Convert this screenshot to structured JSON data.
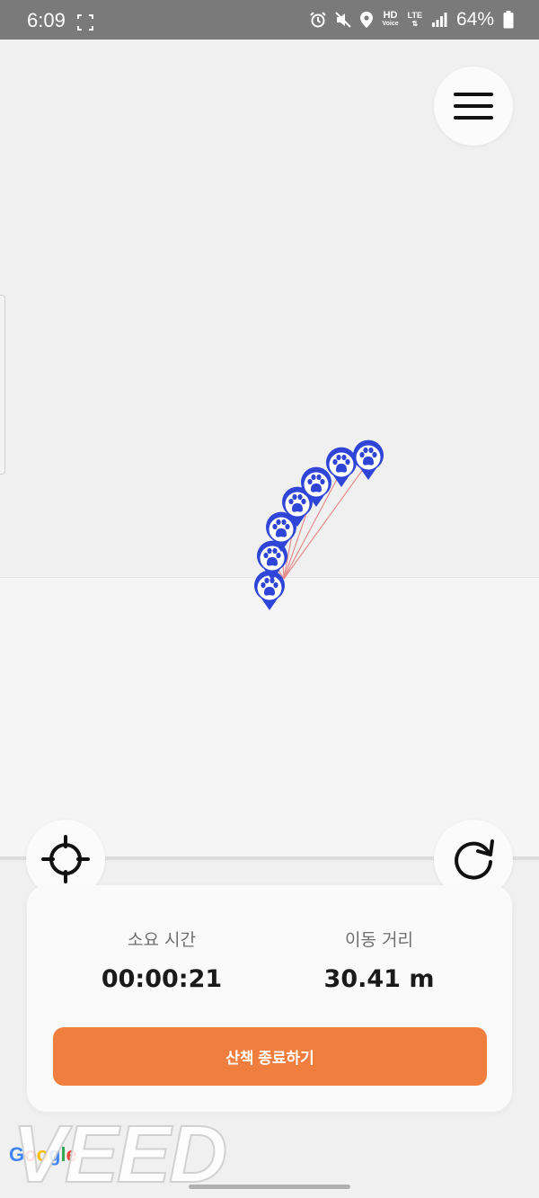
{
  "status_bar": {
    "time": "6:09",
    "hd_top": "HD",
    "hd_bottom": "Voice",
    "lte": "LTE",
    "battery": "64%"
  },
  "colors": {
    "accent": "#f07e3f",
    "marker": "#2f45d8",
    "path": "#e26a6a"
  },
  "icons": {
    "menu": "menu-icon",
    "locate": "crosshair-icon",
    "refresh": "refresh-icon",
    "marker": "paw-marker-icon"
  },
  "stats": {
    "time_label": "소요 시간",
    "time_value": "00:00:21",
    "distance_label": "이동 거리",
    "distance_value": "30.41 m"
  },
  "end_button": "산책 종료하기",
  "google_logo": "Google",
  "watermark": "VEED"
}
